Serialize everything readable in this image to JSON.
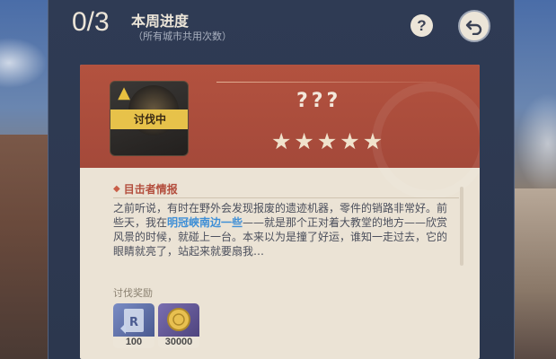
{
  "header": {
    "counter": "0/3",
    "title": "本周进度",
    "subtitle": "（所有城市共用次数）",
    "help_symbol": "?"
  },
  "boss": {
    "name": "???",
    "status": "讨伐中",
    "stars": 5,
    "warning_icon": "warning-triangle-icon"
  },
  "intel": {
    "section_title": "目击者情报",
    "text_before": "之前听说，有时在野外会发现报废的遗迹机器，零件的销路非常好。前些天，我在",
    "highlight": "明冠峡南边一些",
    "text_after": "——就是那个正对着大教堂的地方——欣赏风景的时候，就碰上一台。本来以为是撞了好运，谁知一走过去，它的眼睛就亮了，站起来就要扇我…"
  },
  "rewards": {
    "label": "讨伐奖励",
    "items": [
      {
        "name": "adventure-exp-icon",
        "qty": "100",
        "color": "#5a6ea8"
      },
      {
        "name": "mora-icon",
        "qty": "30000",
        "color": "#6a5ea0"
      }
    ]
  },
  "colors": {
    "accent_red": "#a4493a",
    "status_yellow": "#e7c24a",
    "highlight_blue": "#3f8fd6"
  }
}
